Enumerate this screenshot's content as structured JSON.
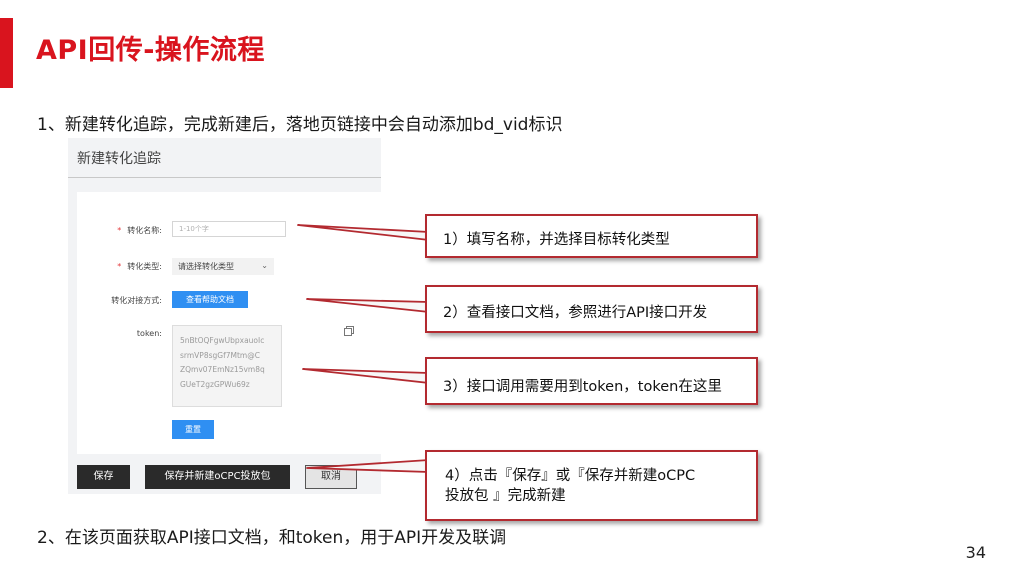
{
  "slide": {
    "title": "API回传-操作流程",
    "step1": "1、新建转化追踪，完成新建后，落地页链接中会自动添加bd_vid标识",
    "step2": "2、在该页面获取API接口文档，和token，用于API开发及联调",
    "page_number": "34"
  },
  "form": {
    "panel_title": "新建转化追踪",
    "name_label": "转化名称:",
    "name_placeholder": "1-10个字",
    "type_label": "转化类型:",
    "type_value": "请选择转化类型",
    "method_label": "转化对接方式:",
    "help_button": "查看帮助文档",
    "token_label": "token:",
    "token_lines": [
      "5nBtOQFgwUbpxauoIc",
      "srmVP8sgGf7Mtm@C",
      "ZQmv07EmNz15vm8q",
      "GUeT2gzGPWu69z"
    ],
    "reset_button": "重置",
    "save_button": "保存",
    "save_new_button": "保存并新建oCPC投放包",
    "cancel_button": "取消"
  },
  "callouts": {
    "c1": "1）填写名称，并选择目标转化类型",
    "c2": "2）查看接口文档，参照进行API接口开发",
    "c3": "3）接口调用需要用到token，token在这里",
    "c4_line1": "4）点击『保存』或『保存并新建oCPC",
    "c4_line2": "投放包 』完成新建"
  },
  "colors": {
    "accent": "#d9141e",
    "callout_border": "#b32a30",
    "button_blue": "#2f8ff2",
    "button_dark": "#2a2a2a"
  }
}
